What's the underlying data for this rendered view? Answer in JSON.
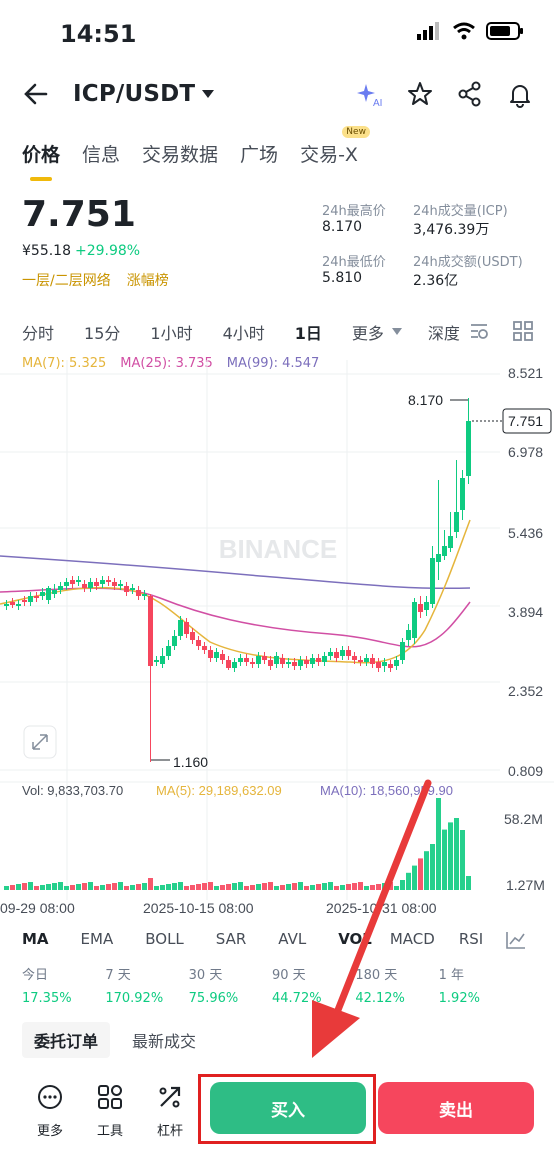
{
  "status": {
    "time": "14:51"
  },
  "header": {
    "pair": "ICP/USDT"
  },
  "tabs": [
    {
      "label": "价格",
      "active": true
    },
    {
      "label": "信息"
    },
    {
      "label": "交易数据"
    },
    {
      "label": "广场"
    },
    {
      "label": "交易-X",
      "badge": "New"
    }
  ],
  "price": {
    "last": "7.751",
    "cny": "¥55.18",
    "change": "+29.98%",
    "tags": [
      "一层/二层网络",
      "涨幅榜"
    ]
  },
  "stats": [
    {
      "label": "24h最高价",
      "value": "8.170"
    },
    {
      "label": "24h成交量(ICP)",
      "value": "3,476.39万"
    },
    {
      "label": "24h最低价",
      "value": "5.810"
    },
    {
      "label": "24h成交额(USDT)",
      "value": "2.36亿"
    }
  ],
  "intervals": [
    "分时",
    "15分",
    "1小时",
    "4小时",
    "1日",
    "更多",
    "深度"
  ],
  "active_interval": "1日",
  "ma_legend": {
    "ma7": "MA(7): 5.325",
    "ma25": "MA(25): 3.735",
    "ma99": "MA(99): 4.547"
  },
  "vol_legend": {
    "vol": "Vol: 9,833,703.70",
    "ma5": "MA(5): 29,189,632.09",
    "ma10": "MA(10): 18,560,959.90"
  },
  "chart_data": {
    "type": "candlestick",
    "y_ticks": [
      "8.521",
      "6.978",
      "5.436",
      "3.894",
      "2.352",
      "0.809"
    ],
    "vol_ticks": [
      "58.2M",
      "1.27M"
    ],
    "x_labels": [
      "09-29 08:00",
      "2025-10-15 08:00",
      "2025-10-31 08:00"
    ],
    "annotations": {
      "high": "8.170",
      "low": "1.160",
      "last": "7.751"
    },
    "watermark": "BINANCE"
  },
  "indicators": [
    "MA",
    "EMA",
    "BOLL",
    "SAR",
    "AVL",
    "VOL",
    "MACD",
    "RSI"
  ],
  "performance": [
    {
      "label": "今日",
      "value": "17.35%"
    },
    {
      "label": "7 天",
      "value": "170.92%"
    },
    {
      "label": "30 天",
      "value": "75.96%"
    },
    {
      "label": "90 天",
      "value": "44.72%"
    },
    {
      "label": "180 天",
      "value": "42.12%"
    },
    {
      "label": "1 年",
      "value": "1.92%"
    }
  ],
  "order_tabs": [
    "委托订单",
    "最新成交"
  ],
  "bottom": {
    "more": "更多",
    "tools": "工具",
    "leverage": "杠杆",
    "buy": "买入",
    "sell": "卖出"
  },
  "colors": {
    "up": "#0ecb81",
    "down": "#f6465d",
    "accent": "#f0b90b"
  }
}
